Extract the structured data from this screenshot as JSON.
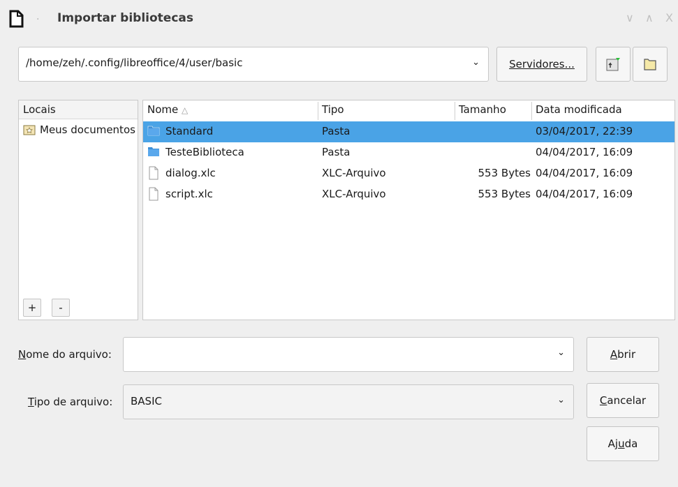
{
  "window": {
    "title": "Importar bibliotecas",
    "dot": "·",
    "controls": {
      "minimize": "∨",
      "maximize": "∧",
      "close": "X"
    }
  },
  "path": {
    "value": "/home/zeh/.config/libreoffice/4/user/basic",
    "arrow": "⌄"
  },
  "toolbar": {
    "servers_label": "Servidores..."
  },
  "places": {
    "header": "Locais",
    "items": [
      {
        "label": "Meus documentos"
      }
    ],
    "add_label": "+",
    "remove_label": "-"
  },
  "files": {
    "columns": {
      "name": "Nome",
      "sort_indicator": "△",
      "type": "Tipo",
      "size": "Tamanho",
      "date": "Data modificada"
    },
    "rows": [
      {
        "name": "Standard",
        "type": "Pasta",
        "size": "",
        "date": "03/04/2017, 22:39",
        "icon": "folder-icon",
        "selected": true
      },
      {
        "name": "TesteBiblioteca",
        "type": "Pasta",
        "size": "",
        "date": "04/04/2017, 16:09",
        "icon": "folder-icon",
        "selected": false
      },
      {
        "name": "dialog.xlc",
        "type": "XLC-Arquivo",
        "size": "553 Bytes",
        "date": "04/04/2017, 16:09",
        "icon": "file-icon",
        "selected": false
      },
      {
        "name": "script.xlc",
        "type": "XLC-Arquivo",
        "size": "553 Bytes",
        "date": "04/04/2017, 16:09",
        "icon": "file-icon",
        "selected": false
      }
    ]
  },
  "filename": {
    "label_access": "N",
    "label_rest": "ome do arquivo:",
    "value": "",
    "arrow": "⌄"
  },
  "filetype": {
    "label_access": "T",
    "label_rest": "ipo de arquivo:",
    "value": "BASIC",
    "arrow": "⌄"
  },
  "buttons": {
    "open_access": "A",
    "open_rest": "brir",
    "cancel_access": "C",
    "cancel_rest": "ancelar",
    "help_pre": "Aj",
    "help_access": "u",
    "help_rest": "da"
  },
  "colors": {
    "selection": "#4aa3e6",
    "folder": "#3d8fd6",
    "background": "#efefef"
  }
}
